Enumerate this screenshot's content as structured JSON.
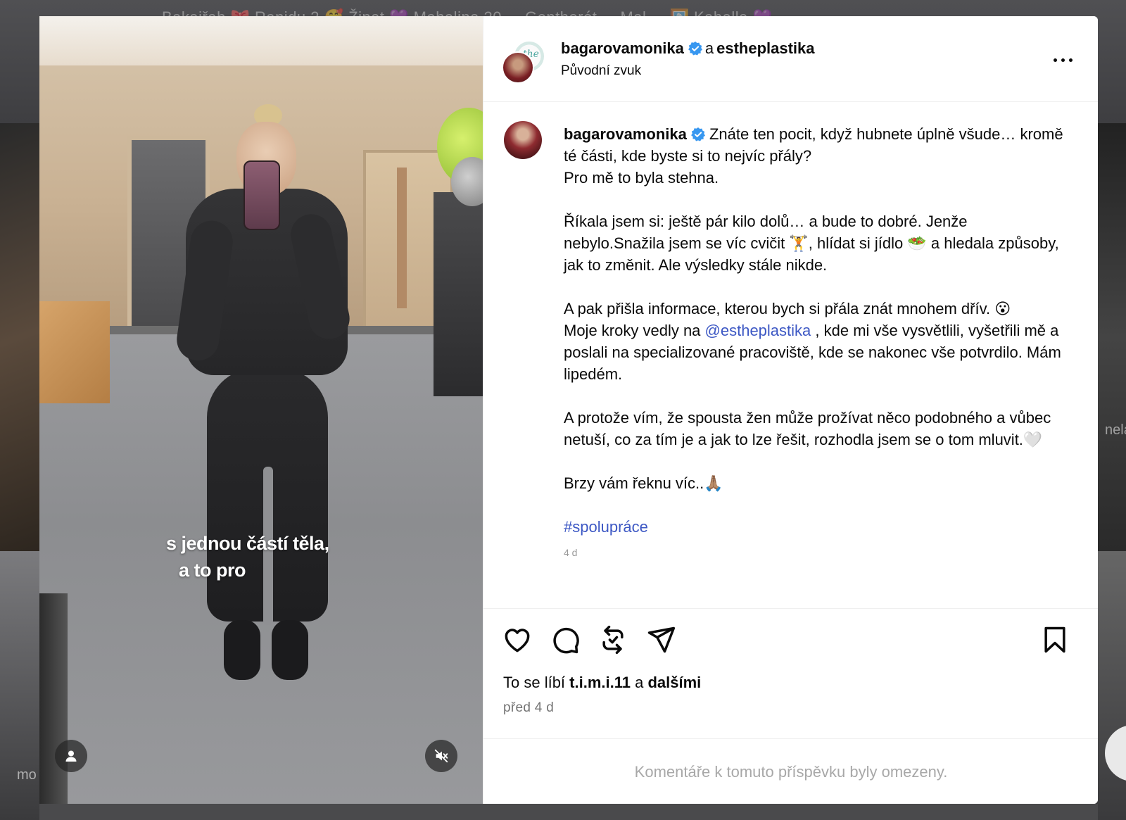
{
  "background": {
    "top_strip_text": "Bakaiřah 🎀   Ranidu 2 🥰   Žinat 💜   Mahalina 20 ...   Gentherét ...   Mal ... 🖼️   Kahalla 💜",
    "left_fragment": "mo",
    "right_fragment": "nela"
  },
  "video": {
    "caption_line1": "s jednou částí těla,",
    "caption_line2": "a to pro",
    "user_button_icon": "person-icon",
    "mute_button_icon": "muted-speaker-icon"
  },
  "header": {
    "username": "bagarovamonika",
    "conjunction": "a",
    "collaborator": "estheplastika",
    "audio": "Původní zvuk",
    "collab_avatar_text": "the",
    "more_icon": "more-horizontal-icon"
  },
  "caption": {
    "username": "bagarovamonika",
    "p1": "Znáte ten pocit, když hubnete úplně všude… kromě té části, kde byste si to nejvíc přály?",
    "p1b": "Pro mě to byla stehna.",
    "p2": "Říkala jsem si: ještě pár kilo dolů… a bude to dobré. Jenže nebylo.Snažila jsem se víc cvičit 🏋️, hlídat si jídlo 🥗 a hledala způsoby, jak to změnit. Ale výsledky stále nikde.",
    "p3": "A pak přišla informace, kterou bych si přála znát mnohem dřív. 😮",
    "p3b_prefix": "Moje kroky vedly na ",
    "p3b_mention": "@estheplastika",
    "p3b_suffix": " , kde mi vše vysvětlili, vyšetřili mě a poslali na specializované pracoviště, kde se nakonec vše potvrdilo. Mám lipedém.",
    "p4": "A protože vím, že spousta žen může prožívat něco podobného a vůbec netuší, co za tím je a jak to lze řešit, rozhodla jsem se o tom mluvit.🤍",
    "p5": "Brzy vám řeknu víc..🙏🏽",
    "hashtag": "#spolupráce",
    "faded": "4 d"
  },
  "actions": {
    "like_icon": "heart-icon",
    "comment_icon": "comment-icon",
    "repost_icon": "repost-icon",
    "share_icon": "paper-plane-icon",
    "save_icon": "bookmark-icon",
    "likes_prefix": "To se líbí ",
    "likes_user": "t.i.m.i.11",
    "likes_mid": " a ",
    "likes_others": "dalšími",
    "time": "před 4 d"
  },
  "footer": {
    "comments_limited": "Komentáře k tomuto příspěvku byly omezeny."
  },
  "colors": {
    "verified_blue": "#3797f0",
    "link_blue": "#3d58c4",
    "muted_text": "#737373",
    "border": "#efefef"
  }
}
